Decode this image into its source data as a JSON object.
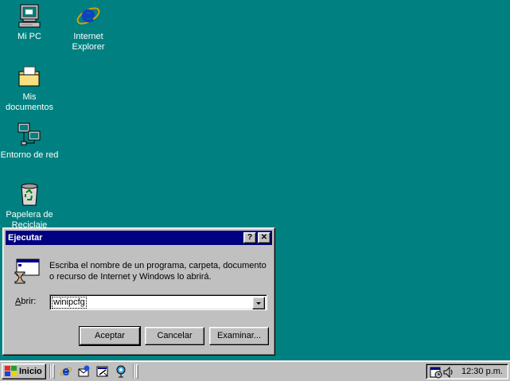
{
  "desktop": {
    "icons": [
      {
        "label": "Mi PC",
        "icon": "my-computer-icon"
      },
      {
        "label": "Internet\nExplorer",
        "icon": "internet-explorer-icon"
      },
      {
        "label": "Mis\ndocumentos",
        "icon": "my-documents-folder-icon"
      },
      {
        "label": "Entorno de red",
        "icon": "network-neighborhood-icon"
      },
      {
        "label": "Papelera de\nReciclaje",
        "icon": "recycle-bin-icon"
      }
    ],
    "background_color": "#008080"
  },
  "run_dialog": {
    "title": "Ejecutar",
    "help_label": "?",
    "close_label": "✕",
    "description": "Escriba el nombre de un programa, carpeta, documento o recurso de Internet y Windows lo abrirá.",
    "open_label_prefix": "",
    "open_label_underlined": "A",
    "open_label_rest": "brir:",
    "open_value": "winipcfg",
    "ok_label": "Aceptar",
    "cancel_label": "Cancelar",
    "browse_label": "Examinar...",
    "title_color": "#000080"
  },
  "taskbar": {
    "start_label": "Inicio",
    "quick_launch": [
      "internet-explorer-icon",
      "outlook-express-icon",
      "show-desktop-icon",
      "channels-icon"
    ],
    "tray_icons": [
      "scheduler-icon",
      "volume-icon"
    ],
    "clock": "12:30 p.m."
  }
}
